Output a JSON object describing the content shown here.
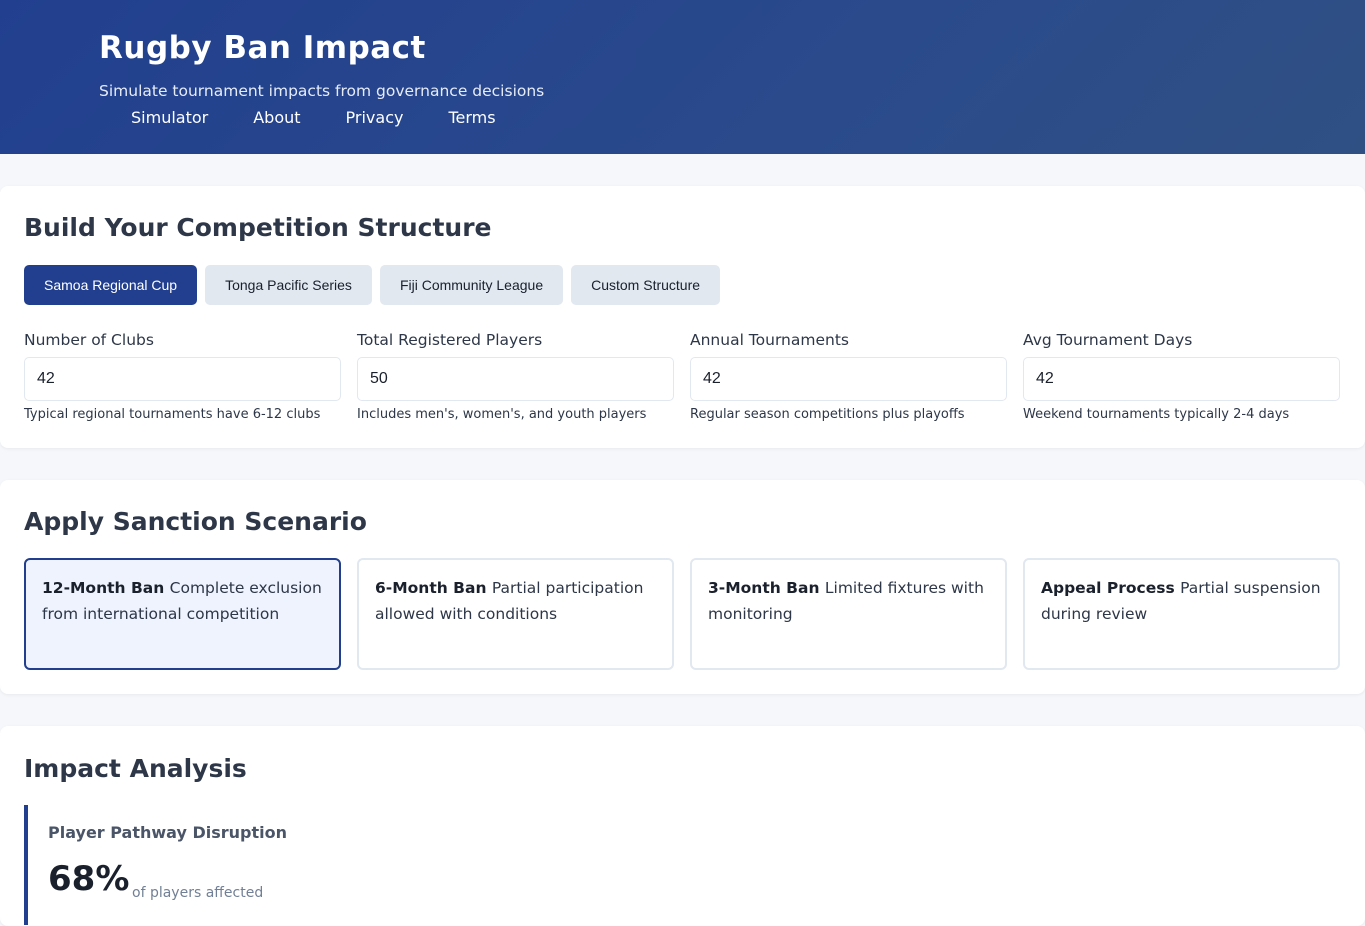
{
  "header": {
    "title": "Rugby Ban Impact",
    "subtitle": "Simulate tournament impacts from governance decisions",
    "nav": [
      "Simulator",
      "About",
      "Privacy",
      "Terms"
    ]
  },
  "structure": {
    "title": "Build Your Competition Structure",
    "tabs": [
      "Samoa Regional Cup",
      "Tonga Pacific Series",
      "Fiji Community League",
      "Custom Structure"
    ],
    "active_tab": "Samoa Regional Cup",
    "fields": [
      {
        "label": "Number of Clubs",
        "value": "42",
        "hint": "Typical regional tournaments have 6-12 clubs"
      },
      {
        "label": "Total Registered Players",
        "value": "50",
        "hint": "Includes men's, women's, and youth players"
      },
      {
        "label": "Annual Tournaments",
        "value": "42",
        "hint": "Regular season competitions plus playoffs"
      },
      {
        "label": "Avg Tournament Days",
        "value": "42",
        "hint": "Weekend tournaments typically 2-4 days"
      }
    ]
  },
  "sanction": {
    "title": "Apply Sanction Scenario",
    "scenarios": [
      {
        "name": "12-Month Ban",
        "desc": "Complete exclusion from international competition"
      },
      {
        "name": "6-Month Ban",
        "desc": "Partial participation allowed with conditions"
      },
      {
        "name": "3-Month Ban",
        "desc": "Limited fixtures with monitoring"
      },
      {
        "name": "Appeal Process",
        "desc": "Partial suspension during review"
      }
    ],
    "selected": "12-Month Ban"
  },
  "impact": {
    "title": "Impact Analysis",
    "metric_title": "Player Pathway Disruption",
    "metric_value": "68%",
    "metric_unit": "of players affected"
  },
  "colors": {
    "primary": "#213f8e",
    "selected_bg": "#eef3fd"
  }
}
